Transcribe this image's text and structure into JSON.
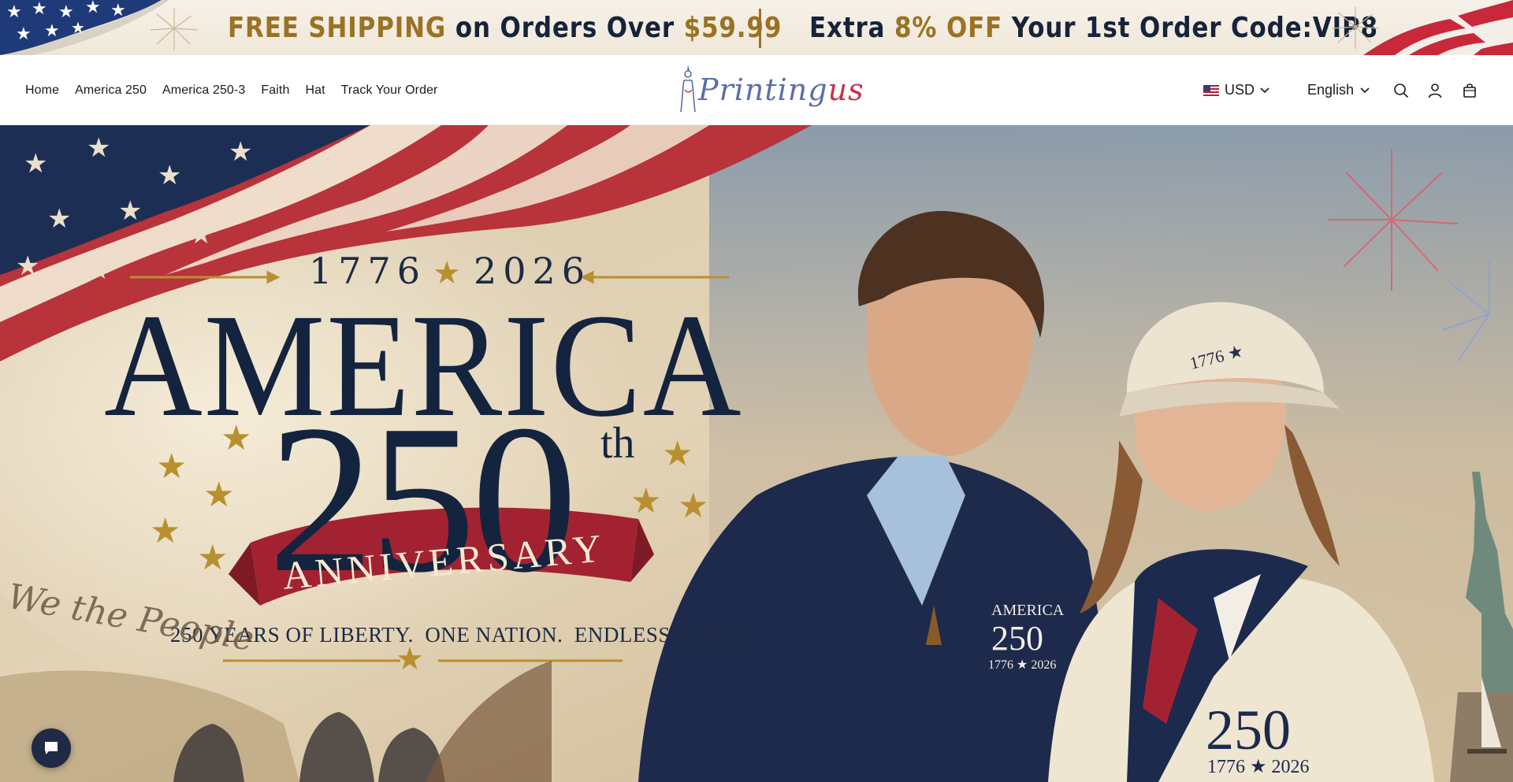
{
  "promo": {
    "left": {
      "part1": "FREE SHIPPING",
      "part2": " on Orders Over ",
      "part3": "$59.99"
    },
    "right": {
      "part1": "Extra ",
      "part2": "8% OFF",
      "part3": " Your 1st Order Code:VIP8"
    }
  },
  "nav": {
    "items": [
      "Home",
      "America 250",
      "America 250-3",
      "Faith",
      "Hat",
      "Track Your Order"
    ]
  },
  "logo": {
    "text_a": "Printing",
    "text_b": "us"
  },
  "currency": {
    "code": "USD",
    "flag_icon": "us-flag-icon"
  },
  "language": {
    "label": "English"
  },
  "icons": {
    "search": "search-icon",
    "account": "user-icon",
    "cart": "cart-icon",
    "chat": "chat-icon"
  },
  "hero": {
    "year_start": "1776",
    "year_star": "★",
    "year_end": "2026",
    "headline": "AMERICA",
    "number": "250",
    "ordinal": "th",
    "ribbon": "ANNIVERSARY",
    "tagline": "250 YEARS OF LIBERTY.  ONE NATION.  ENDLESS STYLE.",
    "script_text": "We the People",
    "patch_left": {
      "line1": "AMERICA",
      "line2": "250",
      "line3": "1776 ★ 2026"
    },
    "patch_right": {
      "line1": "250",
      "line2": "1776 ★ 2026"
    },
    "cap_text": "1776"
  },
  "colors": {
    "navy": "#14243f",
    "gold": "#9b7223",
    "red": "#b22234",
    "cream": "#f6f1e8"
  }
}
